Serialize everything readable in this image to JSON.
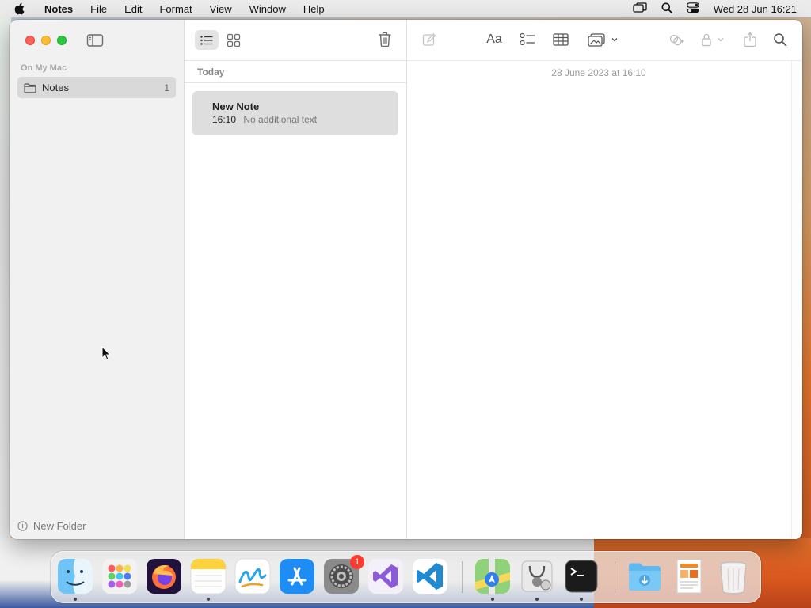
{
  "menubar": {
    "app_name": "Notes",
    "menus": [
      "File",
      "Edit",
      "Format",
      "View",
      "Window",
      "Help"
    ],
    "clock": "Wed 28 Jun  16:21"
  },
  "sidebar": {
    "section_label": "On My Mac",
    "folders": [
      {
        "label": "Notes",
        "count": "1"
      }
    ],
    "new_folder_label": "New Folder"
  },
  "note_list": {
    "group_header": "Today",
    "notes": [
      {
        "title": "New Note",
        "time": "16:10",
        "snippet": "No additional text"
      }
    ]
  },
  "editor": {
    "date": "28 June 2023 at 16:10"
  },
  "dock": {
    "apps": [
      "finder-icon",
      "launchpad-icon",
      "firefox-icon",
      "notes-icon",
      "freeform-icon",
      "app-store-icon",
      "system-settings-icon",
      "visual-studio-icon",
      "vscode-icon",
      "maps-icon",
      "disk-utility-icon",
      "terminal-icon",
      "downloads-icon",
      "preview-icon",
      "trash-icon"
    ],
    "system_settings_badge": "1"
  },
  "colors": {
    "close": "#fe5f57",
    "minimize": "#febc2e",
    "zoom": "#28c840",
    "selection": "#d9d9d9",
    "badge": "#ff3b30"
  }
}
